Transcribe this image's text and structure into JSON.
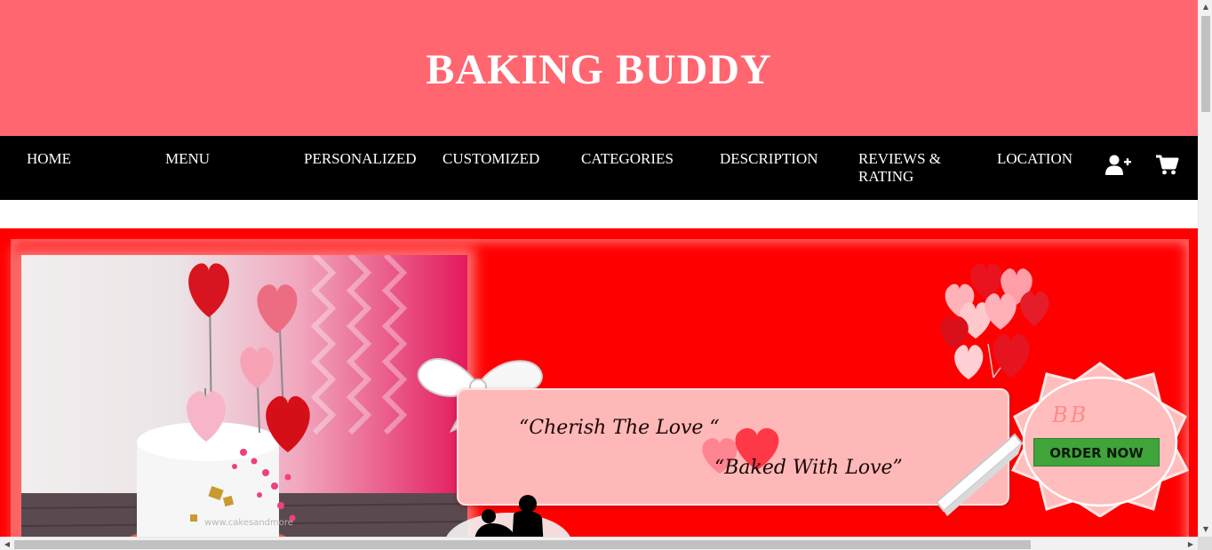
{
  "header": {
    "title": "BAKING BUDDY"
  },
  "nav": {
    "items": [
      {
        "label": "HOME"
      },
      {
        "label": "MENU"
      },
      {
        "label": "PERSONALIZED"
      },
      {
        "label": "CUSTOMIZED"
      },
      {
        "label": "CATEGORIES"
      },
      {
        "label": "DESCRIPTION"
      },
      {
        "label": "REVIEWS & RATING"
      },
      {
        "label": "LOCATION"
      }
    ],
    "icons": [
      {
        "name": "add-user-icon"
      },
      {
        "name": "cart-icon"
      }
    ]
  },
  "banner": {
    "tagline_1": "“Cherish The Love “",
    "tagline_2": "“Baked With Love”",
    "badge_initials": "BB",
    "order_button": "ORDER NOW",
    "photo_watermark": "www.cakesandmore",
    "colors": {
      "background": "#ff0000",
      "note": "#ffb8b8",
      "button": "#3fa43a"
    }
  },
  "colors": {
    "header": "#ff6670",
    "navbar": "#000000"
  },
  "scrollbars": {
    "up_arrow": "▲",
    "down_arrow": "▼",
    "left_arrow": "◀",
    "right_arrow": "▶"
  }
}
